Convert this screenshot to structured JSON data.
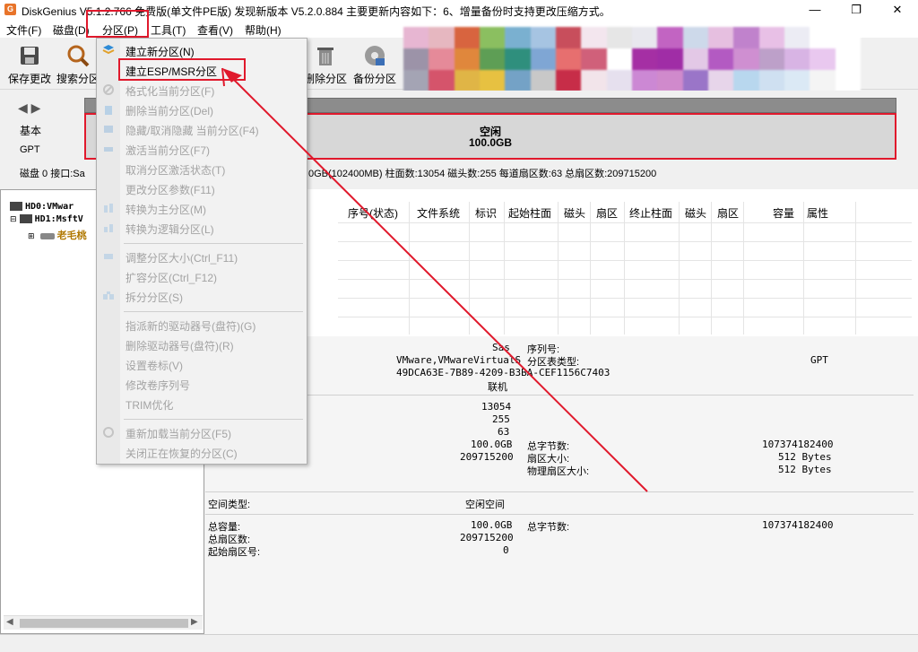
{
  "titlebar": {
    "title": "DiskGenius V5.1.2.766 免费版(单文件PE版)   发现新版本 V5.2.0.884 主要更新内容如下：6、增量备份时支持更改压缩方式。",
    "minimize": "—",
    "maximize": "❐",
    "close": "✕"
  },
  "menubar": {
    "items": [
      "文件(F)",
      "磁盘(D)",
      "分区(P)",
      "工具(T)",
      "查看(V)",
      "帮助(H)"
    ]
  },
  "toolbar": {
    "save": "保存更改",
    "search": "搜索分区",
    "delete": "删除分区",
    "backup": "备份分区"
  },
  "disk_panel": {
    "label_basic": "基本",
    "label_gpt": "GPT",
    "free_label": "空闲",
    "free_size": "100.0GB",
    "info_left": "磁盘 0 接口:Sa",
    "info_right": "0GB(102400MB)  柱面数:13054  磁头数:255  每道扇区数:63  总扇区数:209715200"
  },
  "tree": {
    "hd0": "HD0:VMwar",
    "hd1": "HD1:MsftV",
    "sub": "老毛桃"
  },
  "table": {
    "headers": [
      "序号(状态)",
      "文件系统",
      "标识",
      "起始柱面",
      "磁头",
      "扇区",
      "终止柱面",
      "磁头",
      "扇区",
      "容量",
      "属性"
    ]
  },
  "details": {
    "interface": "Sas",
    "model": "VMware,VMwareVirtualS",
    "guid": "49DCA63E-7B89-4209-B3BA-CEF1156C7403",
    "status": "联机",
    "serial_label": "序列号:",
    "table_type_label": "分区表类型:",
    "table_type": "GPT",
    "cylinders": "13054",
    "heads": "255",
    "sectors": "63",
    "capacity": "100.0GB",
    "total_sectors": "209715200",
    "total_bytes_label": "总字节数:",
    "total_bytes": "107374182400",
    "sector_size_label": "扇区大小:",
    "sector_size": "512 Bytes",
    "phys_sector_label": "物理扇区大小:",
    "phys_sector": "512 Bytes",
    "space_type_label": "空间类型:",
    "space_type": "空闲空间",
    "total_cap_label": "总容量:",
    "total_cap": "100.0GB",
    "total_sec_label": "总扇区数:",
    "total_sec": "209715200",
    "start_sec_label": "起始扇区号:",
    "start_sec": "0",
    "total_bytes2_label": "总字节数:",
    "total_bytes2": "107374182400"
  },
  "dropdown": {
    "items": [
      {
        "label": "建立新分区(N)",
        "enabled": true
      },
      {
        "label": "建立ESP/MSR分区",
        "enabled": true
      },
      {
        "label": "格式化当前分区(F)",
        "enabled": false
      },
      {
        "label": "删除当前分区(Del)",
        "enabled": false
      },
      {
        "label": "隐藏/取消隐藏 当前分区(F4)",
        "enabled": false
      },
      {
        "label": "激活当前分区(F7)",
        "enabled": false
      },
      {
        "label": "取消分区激活状态(T)",
        "enabled": false
      },
      {
        "label": "更改分区参数(F11)",
        "enabled": false
      },
      {
        "label": "转换为主分区(M)",
        "enabled": false
      },
      {
        "label": "转换为逻辑分区(L)",
        "enabled": false
      },
      {
        "label": "调整分区大小(Ctrl_F11)",
        "enabled": false
      },
      {
        "label": "扩容分区(Ctrl_F12)",
        "enabled": false
      },
      {
        "label": "拆分分区(S)",
        "enabled": false
      },
      {
        "label": "指派新的驱动器号(盘符)(G)",
        "enabled": false
      },
      {
        "label": "删除驱动器号(盘符)(R)",
        "enabled": false
      },
      {
        "label": "设置卷标(V)",
        "enabled": false
      },
      {
        "label": "修改卷序列号",
        "enabled": false
      },
      {
        "label": "TRIM优化",
        "enabled": false
      },
      {
        "label": "重新加载当前分区(F5)",
        "enabled": false
      },
      {
        "label": "关闭正在恢复的分区(C)",
        "enabled": false
      }
    ]
  },
  "colors": {
    "annotation_red": "#e0192c",
    "disk_bar": "#d7d7d7",
    "tree_highlight": "#b07800"
  }
}
